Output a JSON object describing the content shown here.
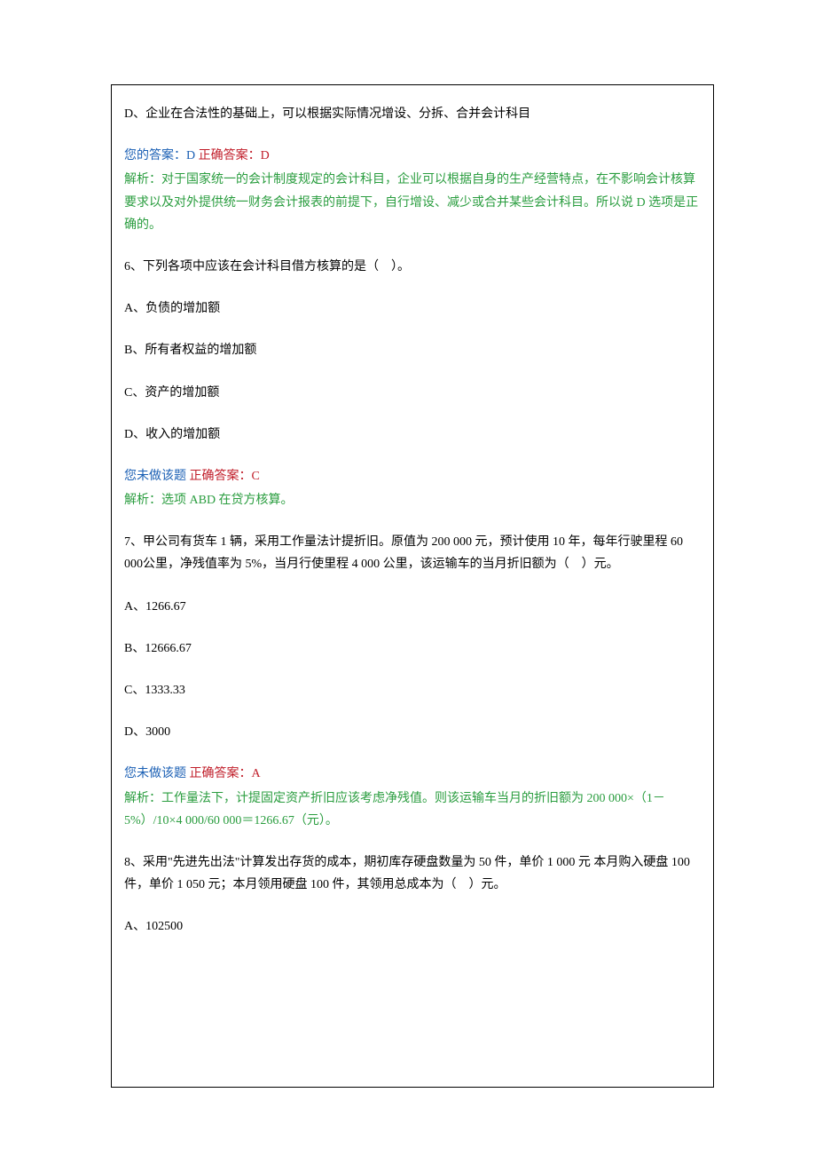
{
  "top_option": "D、企业在合法性的基础上，可以根据实际情况增设、分拆、合并会计科目",
  "q5_answer": {
    "your_label": "您的答案：",
    "your_value": "D",
    "correct_label": " 正确答案：",
    "correct_value": "D"
  },
  "q5_analysis": {
    "label": "解析：",
    "text": "对于国家统一的会计制度规定的会计科目，企业可以根据自身的生产经营特点，在不影响会计核算要求以及对外提供统一财务会计报表的前提下，自行增设、减少或合并某些会计科目。所以说 D 选项是正确的。"
  },
  "q6": {
    "stem": "6、下列各项中应该在会计科目借方核算的是（　）。",
    "a": "A、负债的增加额",
    "b": "B、所有者权益的增加额",
    "c": "C、资产的增加额",
    "d": "D、收入的增加额",
    "status": "您未做该题",
    "correct_label": " 正确答案：",
    "correct_value": "C",
    "analysis_label": "解析：",
    "analysis_text": "选项 ABD 在贷方核算。"
  },
  "q7": {
    "stem": "7、甲公司有货车 1 辆，采用工作量法计提折旧。原值为 200 000 元，预计使用 10 年，每年行驶里程 60 000公里，净残值率为 5%，当月行使里程 4 000 公里，该运输车的当月折旧额为（　）元。",
    "a": "A、1266.67",
    "b": "B、12666.67",
    "c": "C、1333.33",
    "d": "D、3000",
    "status": "您未做该题",
    "correct_label": " 正确答案：",
    "correct_value": "A",
    "analysis_label": "解析：",
    "analysis_text": "工作量法下，计提固定资产折旧应该考虑净残值。则该运输车当月的折旧额为 200 000×（1－5%）/10×4 000/60 000＝1266.67（元）。"
  },
  "q8": {
    "stem": "8、采用\"先进先出法\"计算发出存货的成本，期初库存硬盘数量为 50 件，单价 1 000 元 本月购入硬盘 100 件，单价 1 050 元；本月领用硬盘 100 件，其领用总成本为（　）元。",
    "a": "A、102500"
  }
}
